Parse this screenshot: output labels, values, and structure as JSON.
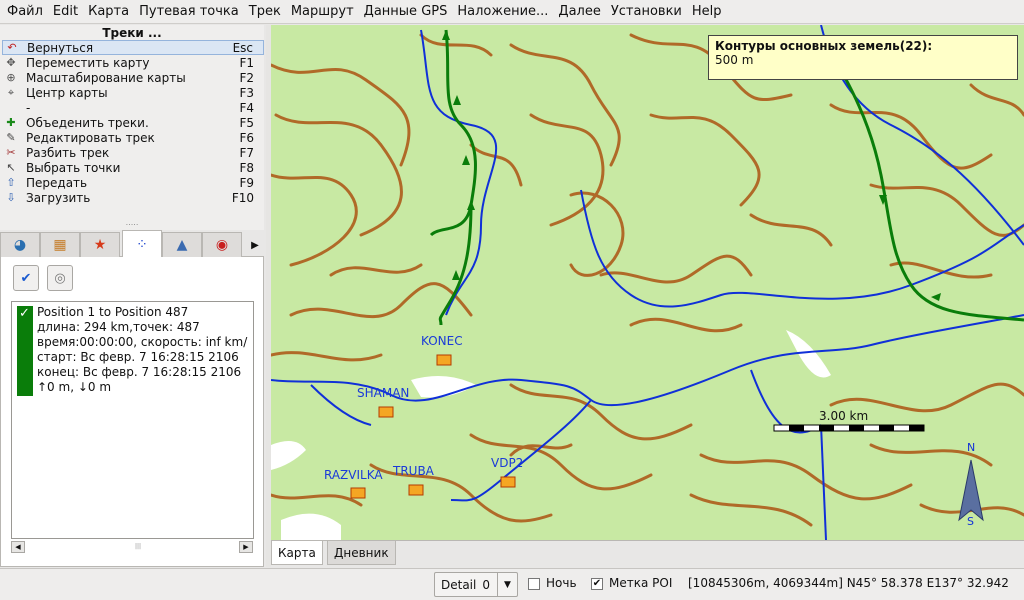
{
  "menu": [
    "Файл",
    "Edit",
    "Карта",
    "Путевая точка",
    "Трек",
    "Маршрут",
    "Данные GPS",
    "Наложение...",
    "Далее",
    "Установки",
    "Help"
  ],
  "actions": {
    "title": "Треки ...",
    "items": [
      {
        "icon": "undo-arrow-icon",
        "label": "Вернуться",
        "key": "Esc"
      },
      {
        "icon": "move-map-icon",
        "label": "Переместить карту",
        "key": "F1"
      },
      {
        "icon": "zoom-map-icon",
        "label": "Масштабирование карты",
        "key": "F2"
      },
      {
        "icon": "center-map-icon",
        "label": "Центр карты",
        "key": "F3"
      },
      {
        "icon": "",
        "label": "-",
        "key": "F4"
      },
      {
        "icon": "combine-tracks-icon",
        "label": "Объеденить треки.",
        "key": "F5"
      },
      {
        "icon": "edit-track-icon",
        "label": "Редактировать трек",
        "key": "F6"
      },
      {
        "icon": "split-track-icon",
        "label": "Разбить трек",
        "key": "F7"
      },
      {
        "icon": "select-points-icon",
        "label": "Выбрать точки",
        "key": "F8"
      },
      {
        "icon": "upload-icon",
        "label": "Передать",
        "key": "F9"
      },
      {
        "icon": "download-icon",
        "label": "Загрузить",
        "key": "F10"
      }
    ]
  },
  "tabs": [
    "globe-icon",
    "map-icon",
    "star-icon",
    "track-icon",
    "route-icon",
    "gps-icon"
  ],
  "track": {
    "lines": [
      "Position 1 to Position 487",
      "длина: 294 km,точек: 487",
      "время:00:00:00, скорость: inf km/",
      "старт: Вс февр. 7 16:28:15 2106",
      "конец: Вс февр. 7 16:28:15 2106",
      "↑0 m, ↓0 m"
    ],
    "color": "#0a7d0a"
  },
  "map": {
    "tooltip_title": "Контуры основных земель(22):",
    "tooltip_value": "500 m",
    "waypoints": [
      "KONEC",
      "SHAMAN",
      "RAZVILKA",
      "TRUBA",
      "VDP2"
    ],
    "scale_label": "3.00 km",
    "north": "N",
    "south": "S"
  },
  "map_tabs": [
    "Карта",
    "Дневник"
  ],
  "status": {
    "detail_label": "Detail",
    "detail_value": "0",
    "night_label": "Ночь",
    "night_checked": false,
    "poi_label": "Метка POI",
    "poi_checked": true,
    "coords": "[10845306m, 4069344m] N45° 58.378 E137° 32.942"
  },
  "colors": {
    "contour": "#b06a28",
    "river": "#1030d8",
    "track": "#0a7d0a",
    "land": "#c8e9a3"
  }
}
